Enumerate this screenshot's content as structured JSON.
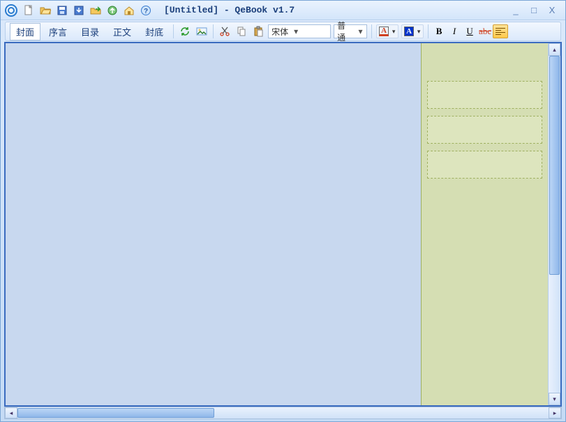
{
  "title": "[Untitled] - QeBook v1.7",
  "titlebar_icons": {
    "new": "新建",
    "open": "打开",
    "save": "保存",
    "import": "导入",
    "export": "导出",
    "publish": "发布",
    "home": "主页",
    "help": "帮助"
  },
  "window_controls": {
    "minimize": "_",
    "maximize": "□",
    "close": "X"
  },
  "tabs": [
    {
      "label": "封面",
      "active": true
    },
    {
      "label": "序言",
      "active": false
    },
    {
      "label": "目录",
      "active": false
    },
    {
      "label": "正文",
      "active": false
    },
    {
      "label": "封底",
      "active": false
    }
  ],
  "edit_icons": {
    "refresh": "刷新",
    "picture": "插图",
    "cut": "剪切",
    "copy": "复制",
    "paste": "粘贴"
  },
  "font": {
    "name": "宋体",
    "size_label": "普通"
  },
  "colors": {
    "text": "#000000",
    "highlight": "#0033cc"
  },
  "format": {
    "bold": "B",
    "italic": "I",
    "underline": "U",
    "strike": "abc"
  }
}
